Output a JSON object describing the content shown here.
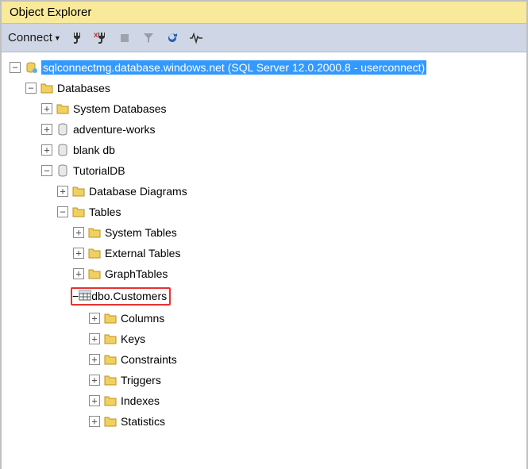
{
  "title": "Object Explorer",
  "toolbar": {
    "connect_label": "Connect"
  },
  "tree": {
    "server": "sqlconnectmg.database.windows.net (SQL Server 12.0.2000.8 - userconnect)",
    "databases": "Databases",
    "system_databases": "System Databases",
    "adventure_works": "adventure-works",
    "blank_db": "blank db",
    "tutorial_db": "TutorialDB",
    "database_diagrams": "Database Diagrams",
    "tables": "Tables",
    "system_tables": "System Tables",
    "external_tables": "External Tables",
    "graph_tables": "GraphTables",
    "dbo_customers": "dbo.Customers",
    "columns": "Columns",
    "keys": "Keys",
    "constraints": "Constraints",
    "triggers": "Triggers",
    "indexes": "Indexes",
    "statistics": "Statistics"
  }
}
